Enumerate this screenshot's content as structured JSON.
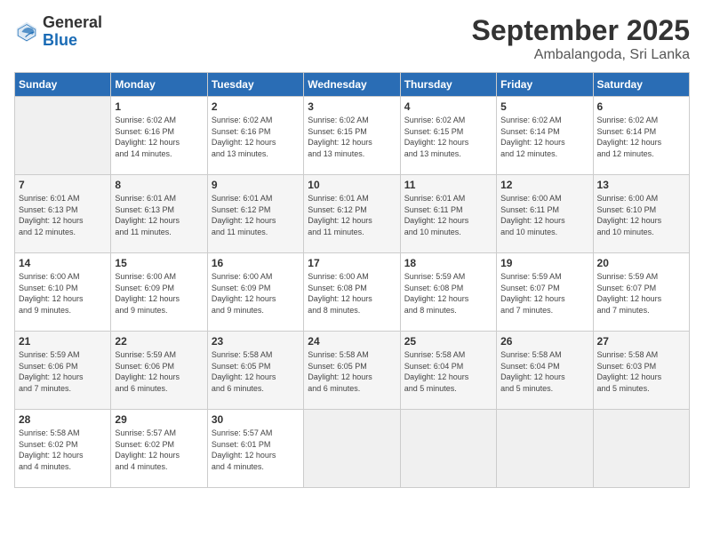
{
  "logo": {
    "text_general": "General",
    "text_blue": "Blue"
  },
  "header": {
    "month_title": "September 2025",
    "subtitle": "Ambalangoda, Sri Lanka"
  },
  "weekdays": [
    "Sunday",
    "Monday",
    "Tuesday",
    "Wednesday",
    "Thursday",
    "Friday",
    "Saturday"
  ],
  "weeks": [
    [
      {
        "day": "",
        "info": ""
      },
      {
        "day": "1",
        "info": "Sunrise: 6:02 AM\nSunset: 6:16 PM\nDaylight: 12 hours\nand 14 minutes."
      },
      {
        "day": "2",
        "info": "Sunrise: 6:02 AM\nSunset: 6:16 PM\nDaylight: 12 hours\nand 13 minutes."
      },
      {
        "day": "3",
        "info": "Sunrise: 6:02 AM\nSunset: 6:15 PM\nDaylight: 12 hours\nand 13 minutes."
      },
      {
        "day": "4",
        "info": "Sunrise: 6:02 AM\nSunset: 6:15 PM\nDaylight: 12 hours\nand 13 minutes."
      },
      {
        "day": "5",
        "info": "Sunrise: 6:02 AM\nSunset: 6:14 PM\nDaylight: 12 hours\nand 12 minutes."
      },
      {
        "day": "6",
        "info": "Sunrise: 6:02 AM\nSunset: 6:14 PM\nDaylight: 12 hours\nand 12 minutes."
      }
    ],
    [
      {
        "day": "7",
        "info": "Sunrise: 6:01 AM\nSunset: 6:13 PM\nDaylight: 12 hours\nand 12 minutes."
      },
      {
        "day": "8",
        "info": "Sunrise: 6:01 AM\nSunset: 6:13 PM\nDaylight: 12 hours\nand 11 minutes."
      },
      {
        "day": "9",
        "info": "Sunrise: 6:01 AM\nSunset: 6:12 PM\nDaylight: 12 hours\nand 11 minutes."
      },
      {
        "day": "10",
        "info": "Sunrise: 6:01 AM\nSunset: 6:12 PM\nDaylight: 12 hours\nand 11 minutes."
      },
      {
        "day": "11",
        "info": "Sunrise: 6:01 AM\nSunset: 6:11 PM\nDaylight: 12 hours\nand 10 minutes."
      },
      {
        "day": "12",
        "info": "Sunrise: 6:00 AM\nSunset: 6:11 PM\nDaylight: 12 hours\nand 10 minutes."
      },
      {
        "day": "13",
        "info": "Sunrise: 6:00 AM\nSunset: 6:10 PM\nDaylight: 12 hours\nand 10 minutes."
      }
    ],
    [
      {
        "day": "14",
        "info": "Sunrise: 6:00 AM\nSunset: 6:10 PM\nDaylight: 12 hours\nand 9 minutes."
      },
      {
        "day": "15",
        "info": "Sunrise: 6:00 AM\nSunset: 6:09 PM\nDaylight: 12 hours\nand 9 minutes."
      },
      {
        "day": "16",
        "info": "Sunrise: 6:00 AM\nSunset: 6:09 PM\nDaylight: 12 hours\nand 9 minutes."
      },
      {
        "day": "17",
        "info": "Sunrise: 6:00 AM\nSunset: 6:08 PM\nDaylight: 12 hours\nand 8 minutes."
      },
      {
        "day": "18",
        "info": "Sunrise: 5:59 AM\nSunset: 6:08 PM\nDaylight: 12 hours\nand 8 minutes."
      },
      {
        "day": "19",
        "info": "Sunrise: 5:59 AM\nSunset: 6:07 PM\nDaylight: 12 hours\nand 7 minutes."
      },
      {
        "day": "20",
        "info": "Sunrise: 5:59 AM\nSunset: 6:07 PM\nDaylight: 12 hours\nand 7 minutes."
      }
    ],
    [
      {
        "day": "21",
        "info": "Sunrise: 5:59 AM\nSunset: 6:06 PM\nDaylight: 12 hours\nand 7 minutes."
      },
      {
        "day": "22",
        "info": "Sunrise: 5:59 AM\nSunset: 6:06 PM\nDaylight: 12 hours\nand 6 minutes."
      },
      {
        "day": "23",
        "info": "Sunrise: 5:58 AM\nSunset: 6:05 PM\nDaylight: 12 hours\nand 6 minutes."
      },
      {
        "day": "24",
        "info": "Sunrise: 5:58 AM\nSunset: 6:05 PM\nDaylight: 12 hours\nand 6 minutes."
      },
      {
        "day": "25",
        "info": "Sunrise: 5:58 AM\nSunset: 6:04 PM\nDaylight: 12 hours\nand 5 minutes."
      },
      {
        "day": "26",
        "info": "Sunrise: 5:58 AM\nSunset: 6:04 PM\nDaylight: 12 hours\nand 5 minutes."
      },
      {
        "day": "27",
        "info": "Sunrise: 5:58 AM\nSunset: 6:03 PM\nDaylight: 12 hours\nand 5 minutes."
      }
    ],
    [
      {
        "day": "28",
        "info": "Sunrise: 5:58 AM\nSunset: 6:02 PM\nDaylight: 12 hours\nand 4 minutes."
      },
      {
        "day": "29",
        "info": "Sunrise: 5:57 AM\nSunset: 6:02 PM\nDaylight: 12 hours\nand 4 minutes."
      },
      {
        "day": "30",
        "info": "Sunrise: 5:57 AM\nSunset: 6:01 PM\nDaylight: 12 hours\nand 4 minutes."
      },
      {
        "day": "",
        "info": ""
      },
      {
        "day": "",
        "info": ""
      },
      {
        "day": "",
        "info": ""
      },
      {
        "day": "",
        "info": ""
      }
    ]
  ]
}
